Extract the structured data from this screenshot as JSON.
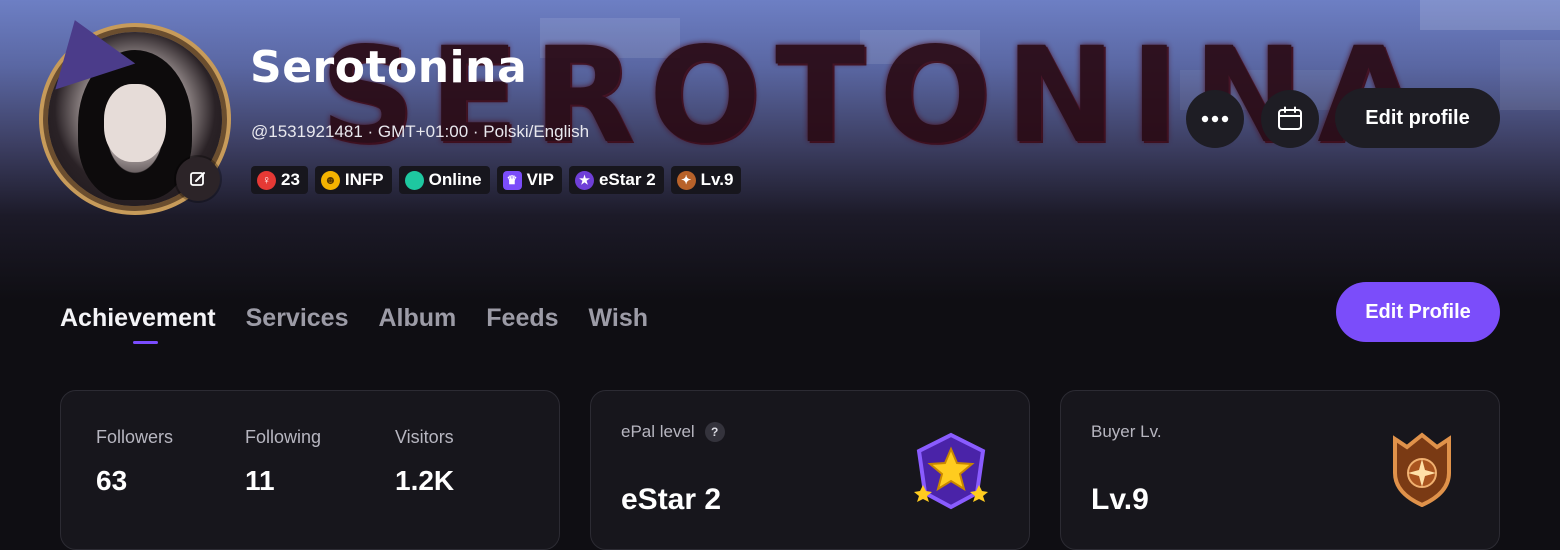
{
  "banner": {
    "art_text": "SEROTONINA"
  },
  "profile": {
    "name": "Serotonina",
    "meta": "@1531921481 · GMT+01:00 · Polski/English",
    "badges": [
      {
        "icon": "female-icon",
        "label": "23",
        "color": "#e53935"
      },
      {
        "icon": "smiley-icon",
        "label": "INFP",
        "color": "#f5b300"
      },
      {
        "icon": "online-dot-icon",
        "label": "Online",
        "color": "#1ec8a0"
      },
      {
        "icon": "vip-crown-icon",
        "label": "VIP",
        "color": "#7b4dfa"
      },
      {
        "icon": "estar-icon",
        "label": "eStar 2",
        "color": "#6f3fd8"
      },
      {
        "icon": "level-compass-icon",
        "label": "Lv.9",
        "color": "#b8622a"
      }
    ]
  },
  "header_actions": {
    "edit_profile_label": "Edit profile"
  },
  "tabs": [
    {
      "label": "Achievement",
      "active": true
    },
    {
      "label": "Services",
      "active": false
    },
    {
      "label": "Album",
      "active": false
    },
    {
      "label": "Feeds",
      "active": false
    },
    {
      "label": "Wish",
      "active": false
    }
  ],
  "edit_profile_button": "Edit Profile",
  "stats": [
    {
      "label": "Followers",
      "value": "63"
    },
    {
      "label": "Following",
      "value": "11"
    },
    {
      "label": "Visitors",
      "value": "1.2K"
    }
  ],
  "epal_card": {
    "title": "ePal level",
    "help": "?",
    "value": "eStar 2"
  },
  "buyer_card": {
    "title": "Buyer Lv.",
    "value": "Lv.9"
  },
  "colors": {
    "accent": "#7b4dfa",
    "background": "#0f0e13",
    "card": "#17161c"
  }
}
